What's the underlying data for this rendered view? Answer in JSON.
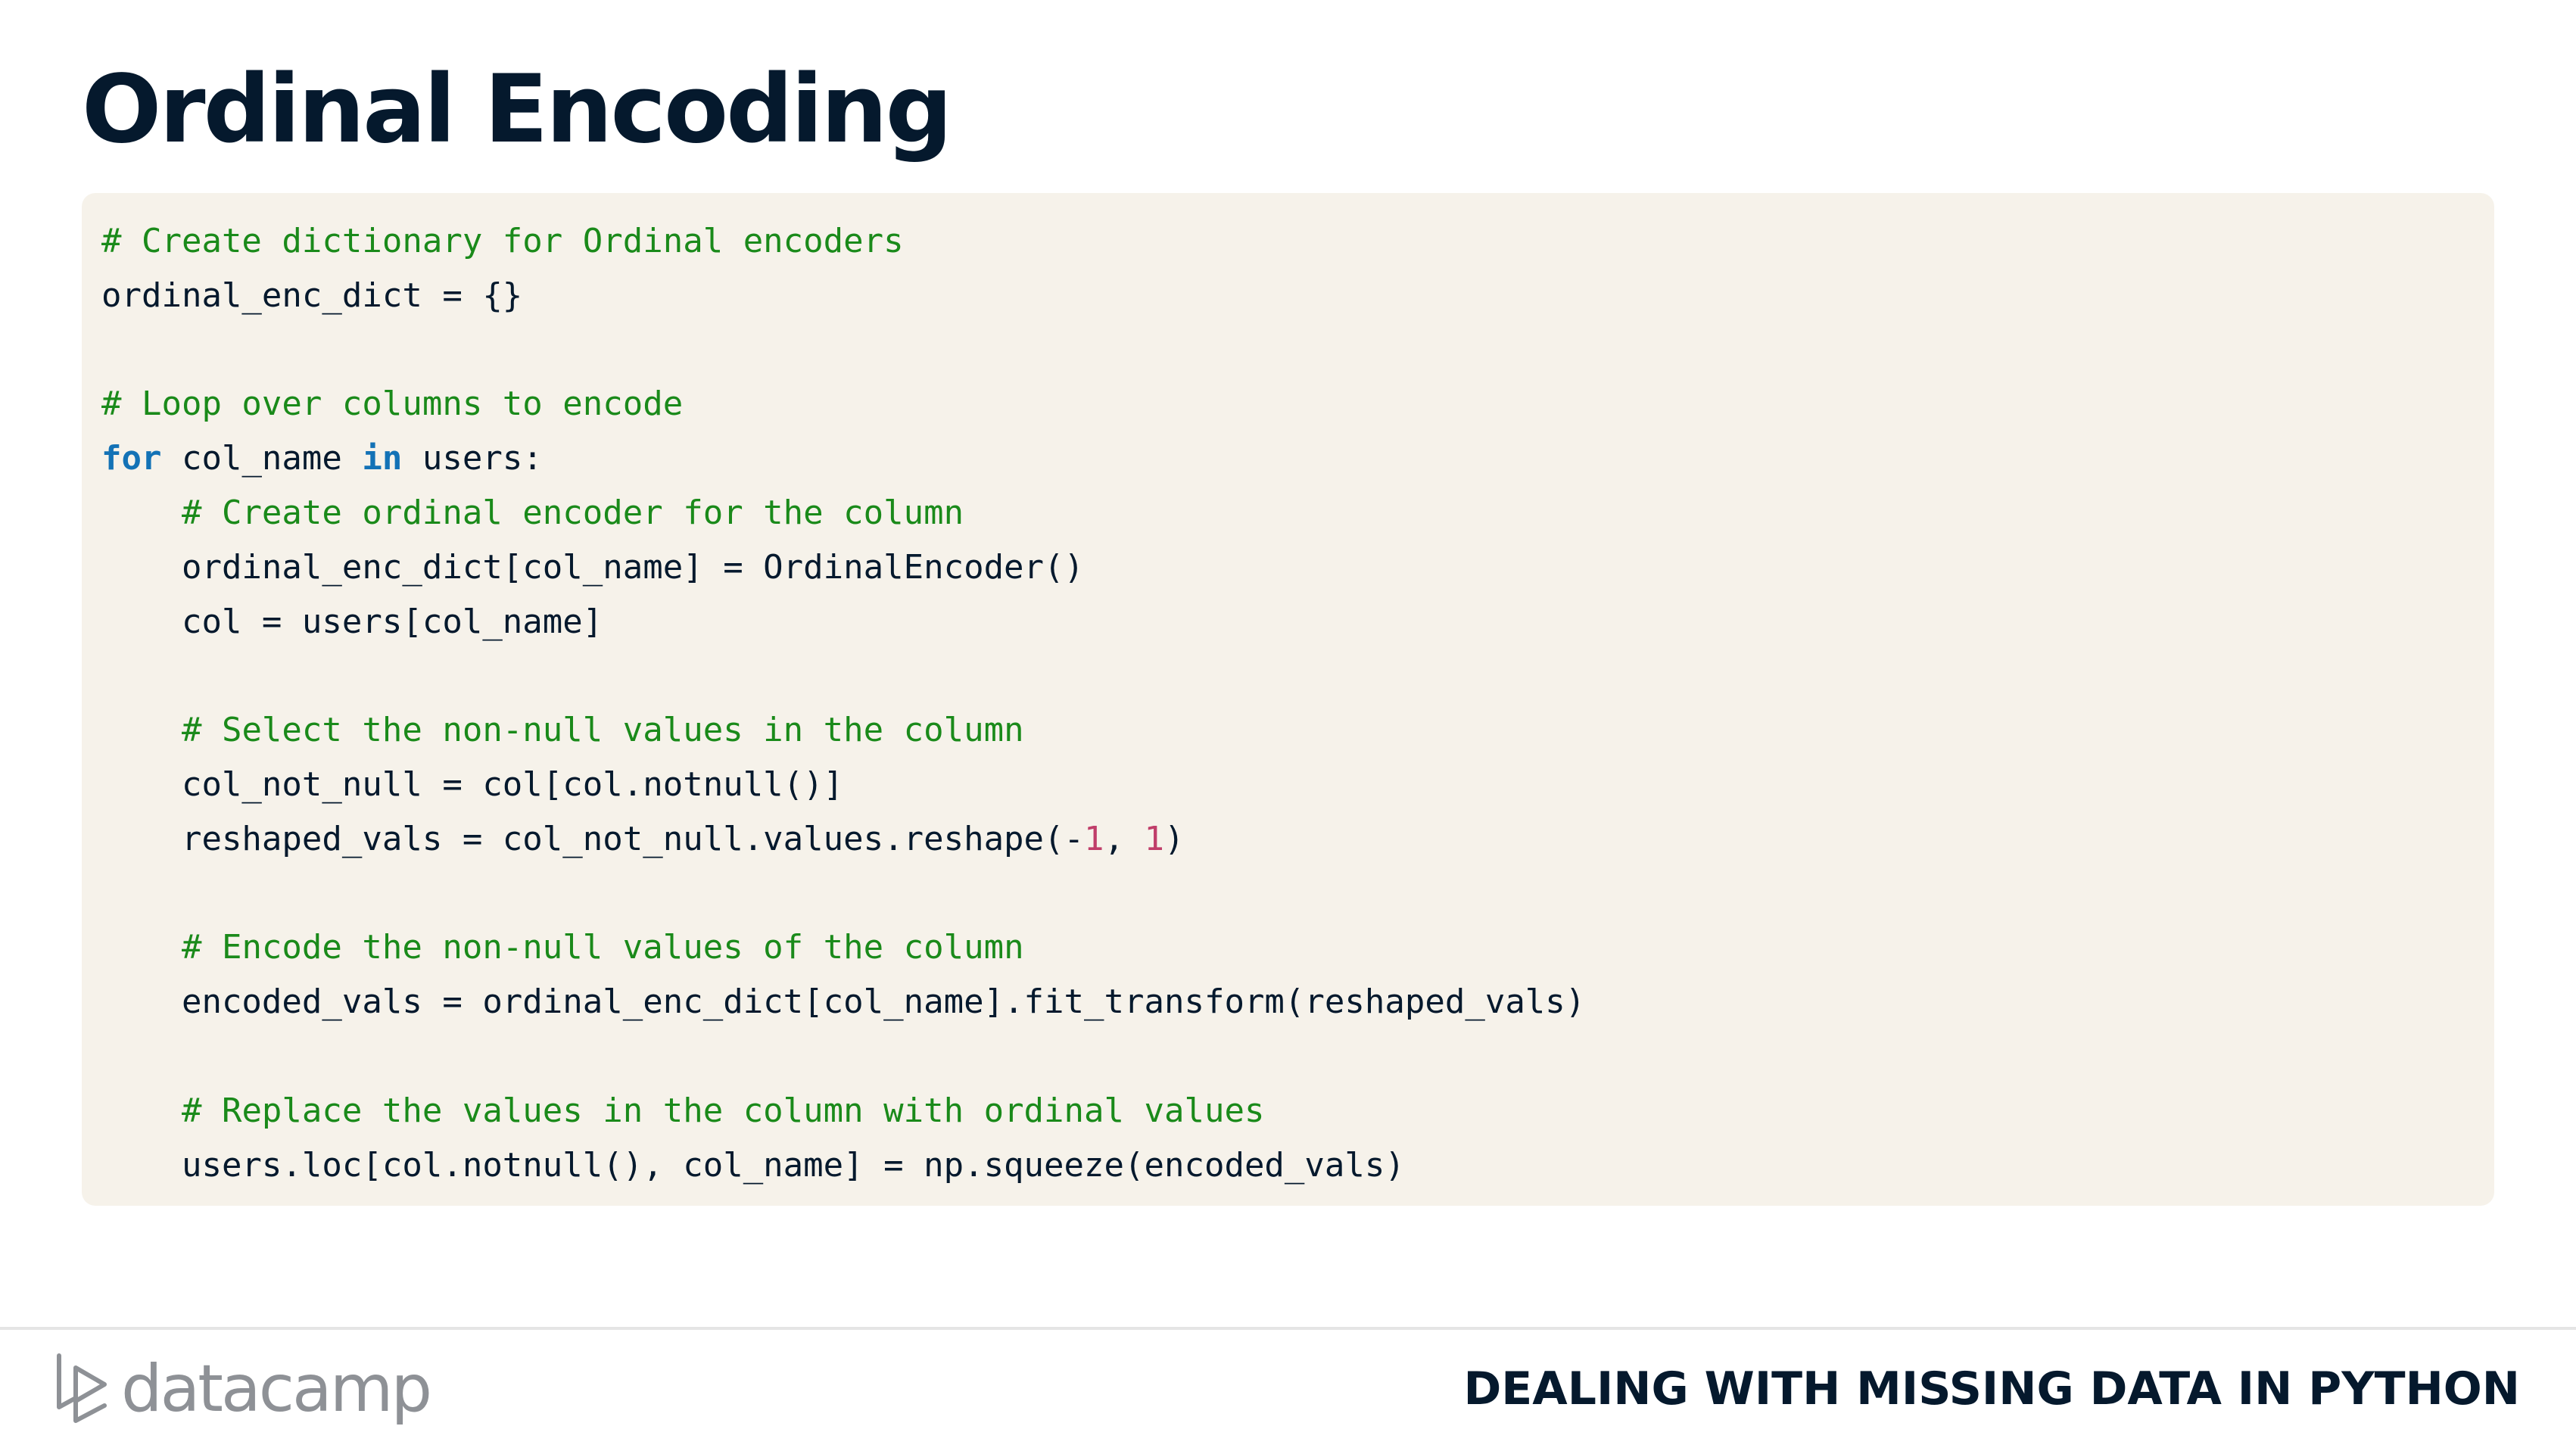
{
  "slide": {
    "title": "Ordinal Encoding"
  },
  "code": {
    "lines": [
      [
        {
          "t": "comment",
          "s": "# Create dictionary for Ordinal encoders"
        }
      ],
      [
        {
          "t": "plain",
          "s": "ordinal_enc_dict = {}"
        }
      ],
      [],
      [
        {
          "t": "comment",
          "s": "# Loop over columns to encode"
        }
      ],
      [
        {
          "t": "keyword",
          "s": "for"
        },
        {
          "t": "plain",
          "s": " col_name "
        },
        {
          "t": "keyword",
          "s": "in"
        },
        {
          "t": "plain",
          "s": " users:"
        }
      ],
      [
        {
          "t": "plain",
          "s": "    "
        },
        {
          "t": "comment",
          "s": "# Create ordinal encoder for the column"
        }
      ],
      [
        {
          "t": "plain",
          "s": "    ordinal_enc_dict[col_name] = OrdinalEncoder()"
        }
      ],
      [
        {
          "t": "plain",
          "s": "    col = users[col_name]"
        }
      ],
      [],
      [
        {
          "t": "plain",
          "s": "    "
        },
        {
          "t": "comment",
          "s": "# Select the non-null values in the column"
        }
      ],
      [
        {
          "t": "plain",
          "s": "    col_not_null = col[col.notnull()]"
        }
      ],
      [
        {
          "t": "plain",
          "s": "    reshaped_vals = col_not_null.values.reshape(-"
        },
        {
          "t": "number",
          "s": "1"
        },
        {
          "t": "plain",
          "s": ", "
        },
        {
          "t": "number",
          "s": "1"
        },
        {
          "t": "plain",
          "s": ")"
        }
      ],
      [],
      [
        {
          "t": "plain",
          "s": "    "
        },
        {
          "t": "comment",
          "s": "# Encode the non-null values of the column"
        }
      ],
      [
        {
          "t": "plain",
          "s": "    encoded_vals = ordinal_enc_dict[col_name].fit_transform(reshaped_vals)"
        }
      ],
      [],
      [
        {
          "t": "plain",
          "s": "    "
        },
        {
          "t": "comment",
          "s": "# Replace the values in the column with ordinal values"
        }
      ],
      [
        {
          "t": "plain",
          "s": "    users.loc[col.notnull(), col_name] = np.squeeze(encoded_vals)"
        }
      ]
    ]
  },
  "footer": {
    "logo_text": "datacamp",
    "logo_icon": "datacamp-logo-icon",
    "course_title": "DEALING WITH MISSING DATA IN PYTHON"
  },
  "colors": {
    "title": "#05192d",
    "code_background": "#f6f2ea",
    "comment": "#1a8a1a",
    "keyword": "#1372b6",
    "number": "#c03e6a",
    "logo": "#8e9196"
  }
}
